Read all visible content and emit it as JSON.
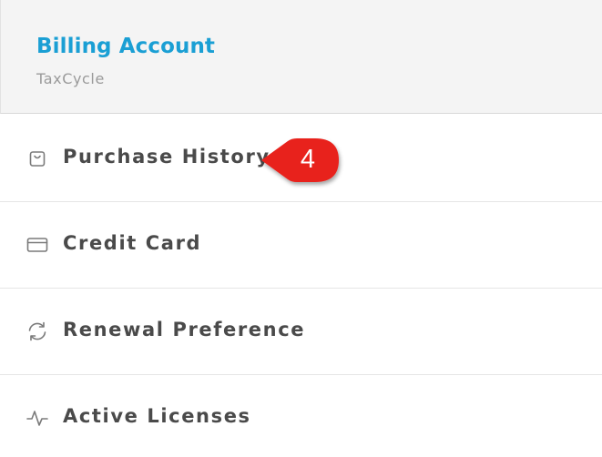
{
  "header": {
    "title": "Billing Account",
    "subtitle": "TaxCycle"
  },
  "menu": {
    "items": [
      {
        "label": "Purchase History",
        "icon": "shopping-bag-icon"
      },
      {
        "label": "Credit Card",
        "icon": "credit-card-icon"
      },
      {
        "label": "Renewal Preference",
        "icon": "refresh-icon"
      },
      {
        "label": "Active Licenses",
        "icon": "activity-icon"
      }
    ]
  },
  "callout": {
    "number": "4",
    "color": "#e8211c"
  },
  "colors": {
    "accent": "#1a9fd4",
    "text": "#4a4a4a",
    "muted": "#9a9a9a",
    "header_bg": "#f4f4f4"
  }
}
